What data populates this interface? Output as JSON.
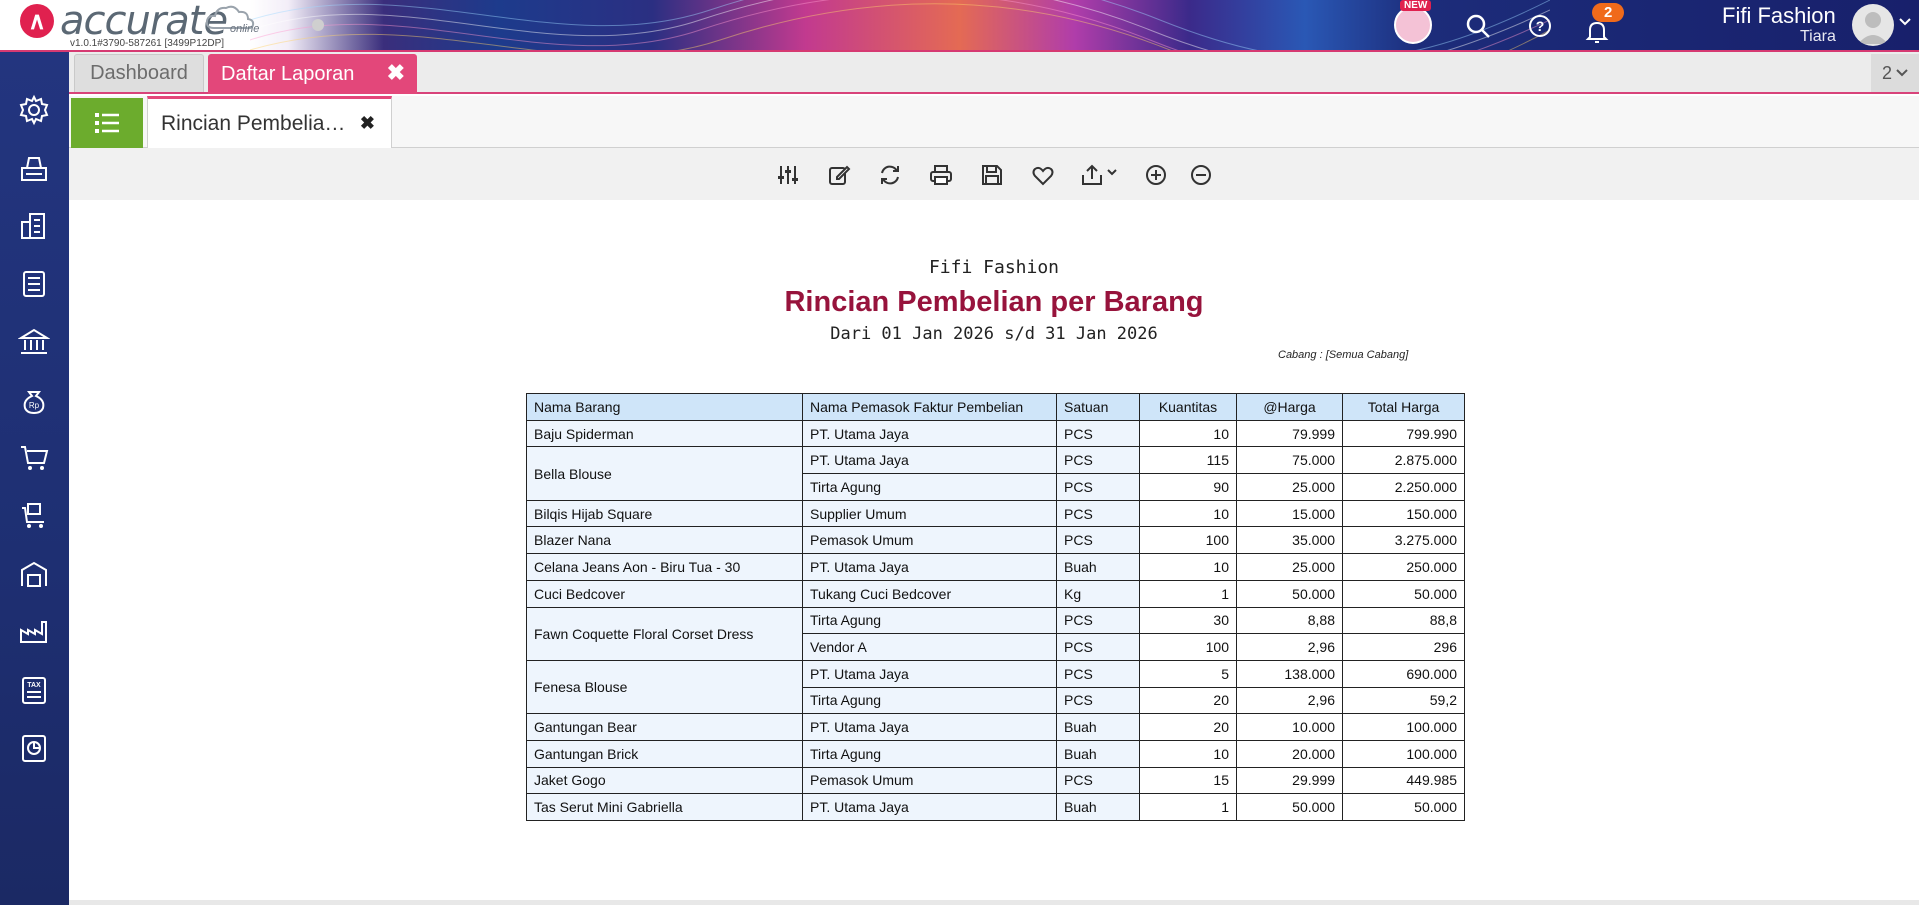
{
  "header": {
    "logo_mark": "∧",
    "logo_text": "accurate",
    "logo_sub": "online",
    "version": "v1.0.1#3790-587261 [3499P12DP]",
    "new_badge": "NEW",
    "notification_count": "2",
    "company": "Fifi Fashion",
    "user": "Tiara"
  },
  "tabs": {
    "dashboard": "Dashboard",
    "laporan": "Daftar Laporan",
    "close": "✖",
    "page_count": "2"
  },
  "subtab": {
    "label": "Rincian Pembelia…",
    "close": "✖"
  },
  "report": {
    "company": "Fifi Fashion",
    "title": "Rincian Pembelian per Barang",
    "period": "Dari 01 Jan 2026 s/d 31 Jan 2026",
    "branch": "Cabang : [Semua Cabang]",
    "columns": [
      "Nama Barang",
      "Nama Pemasok Faktur Pembelian",
      "Satuan",
      "Kuantitas",
      "@Harga",
      "Total Harga"
    ],
    "rows": [
      {
        "item": "Baju Spiderman",
        "supplier": "PT. Utama Jaya",
        "unit": "PCS",
        "qty": "10",
        "price": "79.999",
        "total": "799.990"
      },
      {
        "item": "Bella Blouse",
        "supplier": "PT. Utama Jaya",
        "unit": "PCS",
        "qty": "115",
        "price": "75.000",
        "total": "2.875.000"
      },
      {
        "item": "",
        "supplier": "Tirta Agung",
        "unit": "PCS",
        "qty": "90",
        "price": "25.000",
        "total": "2.250.000"
      },
      {
        "item": "Bilqis Hijab Square",
        "supplier": "Supplier Umum",
        "unit": "PCS",
        "qty": "10",
        "price": "15.000",
        "total": "150.000"
      },
      {
        "item": "Blazer Nana",
        "supplier": "Pemasok Umum",
        "unit": "PCS",
        "qty": "100",
        "price": "35.000",
        "total": "3.275.000"
      },
      {
        "item": "Celana Jeans Aon - Biru Tua - 30",
        "supplier": "PT. Utama Jaya",
        "unit": "Buah",
        "qty": "10",
        "price": "25.000",
        "total": "250.000"
      },
      {
        "item": "Cuci Bedcover",
        "supplier": "Tukang Cuci Bedcover",
        "unit": "Kg",
        "qty": "1",
        "price": "50.000",
        "total": "50.000"
      },
      {
        "item": "Fawn Coquette Floral Corset Dress",
        "supplier": "Tirta Agung",
        "unit": "PCS",
        "qty": "30",
        "price": "8,88",
        "total": "88,8"
      },
      {
        "item": "",
        "supplier": "Vendor A",
        "unit": "PCS",
        "qty": "100",
        "price": "2,96",
        "total": "296"
      },
      {
        "item": "Fenesa Blouse",
        "supplier": "PT. Utama Jaya",
        "unit": "PCS",
        "qty": "5",
        "price": "138.000",
        "total": "690.000"
      },
      {
        "item": "",
        "supplier": "Tirta Agung",
        "unit": "PCS",
        "qty": "20",
        "price": "2,96",
        "total": "59,2"
      },
      {
        "item": "Gantungan Bear",
        "supplier": "PT. Utama Jaya",
        "unit": "Buah",
        "qty": "20",
        "price": "10.000",
        "total": "100.000"
      },
      {
        "item": "Gantungan Brick",
        "supplier": "Tirta Agung",
        "unit": "Buah",
        "qty": "10",
        "price": "20.000",
        "total": "100.000"
      },
      {
        "item": "Jaket Gogo",
        "supplier": "Pemasok Umum",
        "unit": "PCS",
        "qty": "15",
        "price": "29.999",
        "total": "449.985"
      },
      {
        "item": "Tas Serut Mini Gabriella",
        "supplier": "PT. Utama Jaya",
        "unit": "Buah",
        "qty": "1",
        "price": "50.000",
        "total": "50.000"
      }
    ]
  },
  "sidebar_icons": [
    "gear-icon",
    "printer-icon",
    "building-icon",
    "ledger-icon",
    "bank-icon",
    "money-bag-icon",
    "cart-icon",
    "delivery-cart-icon",
    "warehouse-icon",
    "factory-icon",
    "tax-icon",
    "report-chart-icon"
  ],
  "toolbar_icons": [
    "filter-settings-icon",
    "edit-icon",
    "refresh-icon",
    "print-icon",
    "save-icon",
    "favorite-icon",
    "export-icon",
    "zoom-in-icon",
    "zoom-out-icon"
  ],
  "colors": {
    "accent_pink": "#e3477a",
    "title_maroon": "#97133c",
    "sidebar_blue": "#23357f",
    "list_green": "#6cac2d",
    "header_blue": "#cfe5f9",
    "cell_blue": "#eef5fd",
    "badge_orange": "#f06a1b"
  }
}
